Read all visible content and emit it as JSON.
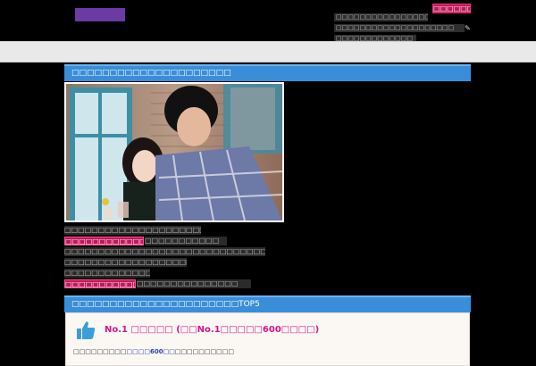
{
  "header": {
    "top_button": "□□□□□□□",
    "lines": [
      "□□□□□□□□□□□□□□□□",
      "□□□□□□□□□□□□□□□□□□□□",
      "□□□□□□□□□□□□□"
    ],
    "mark": "✎"
  },
  "section1": {
    "title": "□□□□□□□□□□□□□□□□□□□□□"
  },
  "body_lines": {
    "l1": "□□□□□□□□□□□□□□□□□□□□□□□□□□",
    "l2_highlight": "□□□□□□□□□□□□□□□□□□",
    "l2_rest": "□□□□□□□□□□□",
    "l3": "□□□□□□□□□□□□□□□□□□□□□□□□□□□□□□□□□□□□",
    "l4": "□□□□□□□□□□□□□□□□□□□□□□□□□□□□□",
    "l5": "□□□□□□□□□□□□□□□□□□□□□",
    "l6_highlight": "□□□□□□□□□□□□□□□□□",
    "l6_rest": "□□□□□□□□□□□□□□□"
  },
  "section2": {
    "title": "□□□□□□□□□□□□□□□□□□□□□□TOP5"
  },
  "ranking": {
    "rank1_title": "No.1 □□□□□ (□□No.1□□□□□600□□□□)",
    "rank1_text_pre": "□□□□□□□□□",
    "rank1_text_hi": "□□□□600□□",
    "rank1_text_post": "□□□□□□□□□□"
  },
  "colors": {
    "background": "#000000",
    "accent_blue": "#3a8ed9",
    "accent_pink": "#c2185b",
    "logo": "#6a3aa5",
    "rank_title": "#d6148b"
  }
}
